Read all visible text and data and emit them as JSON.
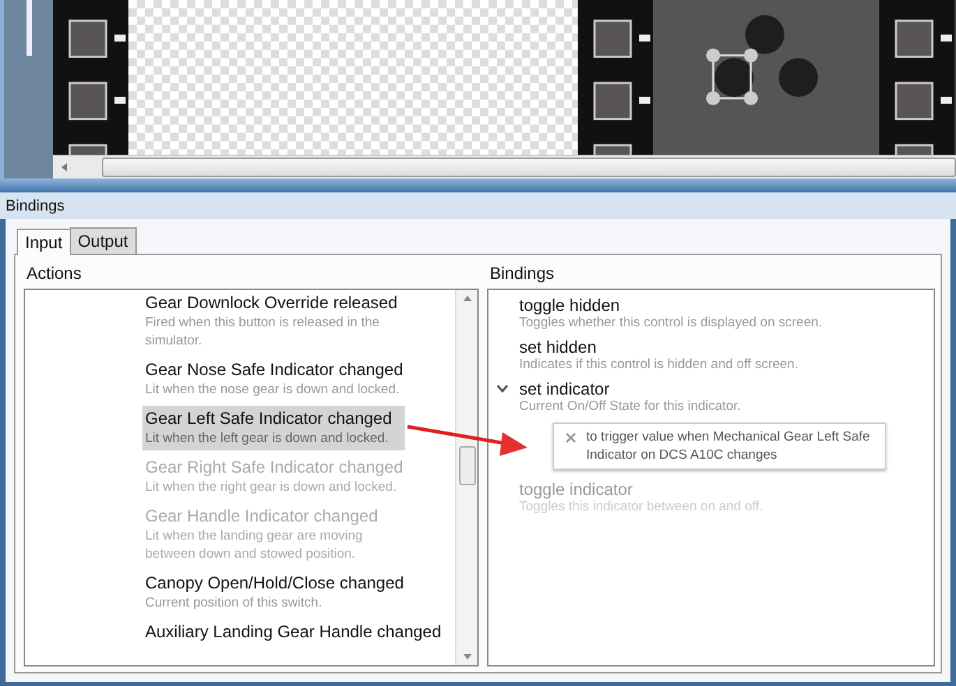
{
  "bindings_panel": {
    "title": "Bindings"
  },
  "tabs": [
    {
      "label": "Input",
      "selected": true
    },
    {
      "label": "Output",
      "selected": false
    }
  ],
  "actions": {
    "label": "Actions",
    "items": [
      {
        "title": "Gear Downlock Override released",
        "description": "Fired when this button is released in the simulator.",
        "selected": false,
        "disabled": false
      },
      {
        "title": "Gear Nose Safe Indicator changed",
        "description": "Lit when the nose gear is down and locked.",
        "selected": false,
        "disabled": false
      },
      {
        "title": "Gear Left Safe Indicator changed",
        "description": "Lit when the left gear is down and locked.",
        "selected": true,
        "disabled": false
      },
      {
        "title": "Gear Right Safe Indicator changed",
        "description": "Lit when the right gear is down and locked.",
        "selected": false,
        "disabled": true
      },
      {
        "title": "Gear Handle Indicator changed",
        "description": "Lit when the landing gear are moving between down and stowed position.",
        "selected": false,
        "disabled": true
      },
      {
        "title": "Canopy Open/Hold/Close changed",
        "description": "Current position of this switch.",
        "selected": false,
        "disabled": false
      },
      {
        "title": "Auxiliary Landing Gear Handle changed",
        "selected": false,
        "disabled": false
      }
    ]
  },
  "bindings": {
    "label": "Bindings",
    "items": [
      {
        "title": "toggle hidden",
        "description": "Toggles whether this control is displayed on screen.",
        "disabled": false,
        "expanded": false
      },
      {
        "title": "set hidden",
        "description": "Indicates if this control is hidden and off screen.",
        "disabled": false,
        "expanded": false
      },
      {
        "title": "set indicator",
        "description": "Current On/Off State for this indicator.",
        "disabled": false,
        "expanded": true,
        "children": [
          {
            "text": "to trigger value when Mechanical Gear Left Safe Indicator on DCS A10C changes"
          }
        ]
      },
      {
        "title": "toggle indicator",
        "description": "Toggles this indicator between on and off.",
        "disabled": true,
        "expanded": false
      }
    ]
  }
}
